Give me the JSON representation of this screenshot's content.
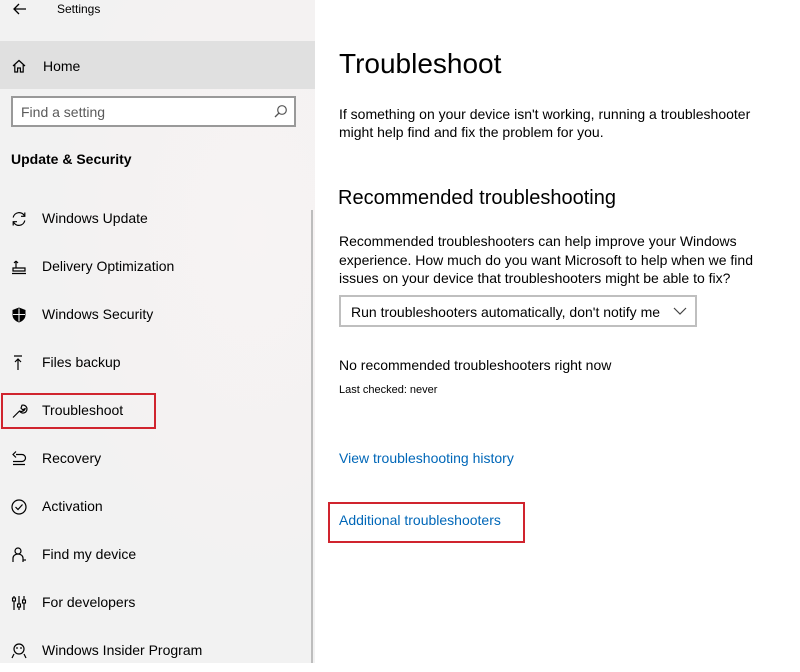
{
  "window": {
    "title": "Settings"
  },
  "sidebar": {
    "home_label": "Home",
    "search": {
      "placeholder": "Find a setting",
      "value": ""
    },
    "section_title": "Update & Security",
    "items": [
      {
        "label": "Windows Update",
        "icon": "sync-icon"
      },
      {
        "label": "Delivery Optimization",
        "icon": "delivery-optimization-icon"
      },
      {
        "label": "Windows Security",
        "icon": "shield-icon"
      },
      {
        "label": "Files backup",
        "icon": "backup-arrow-icon"
      },
      {
        "label": "Troubleshoot",
        "icon": "wrench-icon",
        "selected": true
      },
      {
        "label": "Recovery",
        "icon": "recovery-icon"
      },
      {
        "label": "Activation",
        "icon": "check-circle-icon"
      },
      {
        "label": "Find my device",
        "icon": "person-location-icon"
      },
      {
        "label": "For developers",
        "icon": "developer-sliders-icon"
      },
      {
        "label": "Windows Insider Program",
        "icon": "insider-icon"
      }
    ]
  },
  "main": {
    "title": "Troubleshoot",
    "intro": "If something on your device isn't working, running a troubleshooter might help find and fix the problem for you.",
    "recommended": {
      "heading": "Recommended troubleshooting",
      "description": "Recommended troubleshooters can help improve your Windows experience. How much do you want Microsoft to help when we find issues on your device that troubleshooters might be able to fix?",
      "dropdown_value": "Run troubleshooters automatically, don't notify me",
      "status": "No recommended troubleshooters right now",
      "last_checked": "Last checked: never"
    },
    "links": {
      "history": "View troubleshooting history",
      "additional": "Additional troubleshooters"
    }
  },
  "colors": {
    "highlight_border": "#d0242e",
    "link": "#0067b8",
    "sidebar_bg": "#f2f2f2",
    "home_bg": "#e0e0e0"
  }
}
